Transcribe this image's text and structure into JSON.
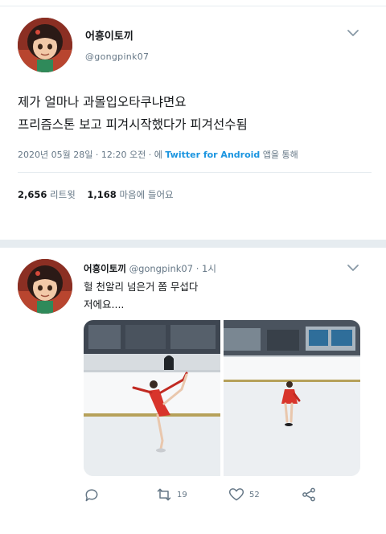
{
  "tweet1": {
    "display_name": "어흥이토끼",
    "handle": "@gongpink07",
    "text_line1": "제가 얼마나 과몰입오타쿠냐면요",
    "text_line2": "프리즘스톤 보고 피겨시작했다가 피겨선수됨",
    "meta_prefix": "2020년 05월 28일 · 12:20 오전 · 에 ",
    "meta_source": "Twitter for Android",
    "meta_suffix": " 앱을 통해",
    "retweet_count": "2,656",
    "retweet_label": "리트윗",
    "like_count": "1,168",
    "like_label": "마음에 들어요"
  },
  "tweet2": {
    "display_name": "어흥이토끼",
    "handle_time": "@gongpink07 · 1시",
    "text_line1": "헐 천알리 넘은거 쫌 무섭다",
    "text_line2": "저에요....",
    "retweet_count": "19",
    "like_count": "52"
  },
  "colors": {
    "link": "#1b95e0",
    "secondary_text": "#657786",
    "divider": "#e6ecf0",
    "icon": "#657786"
  },
  "icons": [
    "chevron-down-icon",
    "reply-icon",
    "retweet-icon",
    "heart-icon",
    "share-icon"
  ]
}
